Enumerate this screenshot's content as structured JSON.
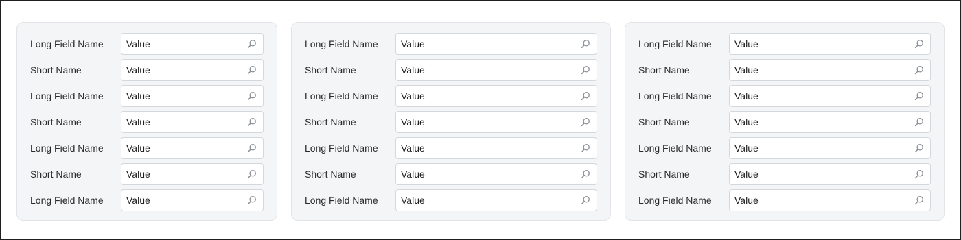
{
  "colors": {
    "panel_bg": "#f4f5f7",
    "input_border": "#d4d7dc",
    "icon": "#8a8f96"
  },
  "panels": [
    {
      "rows": [
        {
          "label": "Long Field Name",
          "value": "Value",
          "icon": "search-icon"
        },
        {
          "label": "Short Name",
          "value": "Value",
          "icon": "search-icon"
        },
        {
          "label": "Long Field Name",
          "value": "Value",
          "icon": "search-icon"
        },
        {
          "label": "Short Name",
          "value": "Value",
          "icon": "search-icon"
        },
        {
          "label": "Long Field Name",
          "value": "Value",
          "icon": "search-icon"
        },
        {
          "label": "Short Name",
          "value": "Value",
          "icon": "search-icon"
        },
        {
          "label": "Long Field Name",
          "value": "Value",
          "icon": "search-icon"
        }
      ]
    },
    {
      "rows": [
        {
          "label": "Long Field Name",
          "value": "Value",
          "icon": "search-icon"
        },
        {
          "label": "Short Name",
          "value": "Value",
          "icon": "search-icon"
        },
        {
          "label": "Long Field Name",
          "value": "Value",
          "icon": "search-icon"
        },
        {
          "label": "Short Name",
          "value": "Value",
          "icon": "search-icon"
        },
        {
          "label": "Long Field Name",
          "value": "Value",
          "icon": "search-icon"
        },
        {
          "label": "Short Name",
          "value": "Value",
          "icon": "search-icon"
        },
        {
          "label": "Long Field Name",
          "value": "Value",
          "icon": "search-icon"
        }
      ]
    },
    {
      "rows": [
        {
          "label": "Long Field Name",
          "value": "Value",
          "icon": "search-icon"
        },
        {
          "label": "Short Name",
          "value": "Value",
          "icon": "search-icon"
        },
        {
          "label": "Long Field Name",
          "value": "Value",
          "icon": "search-icon"
        },
        {
          "label": "Short Name",
          "value": "Value",
          "icon": "search-icon"
        },
        {
          "label": "Long Field Name",
          "value": "Value",
          "icon": "search-icon"
        },
        {
          "label": "Short Name",
          "value": "Value",
          "icon": "search-icon"
        },
        {
          "label": "Long Field Name",
          "value": "Value",
          "icon": "search-icon"
        }
      ]
    }
  ]
}
